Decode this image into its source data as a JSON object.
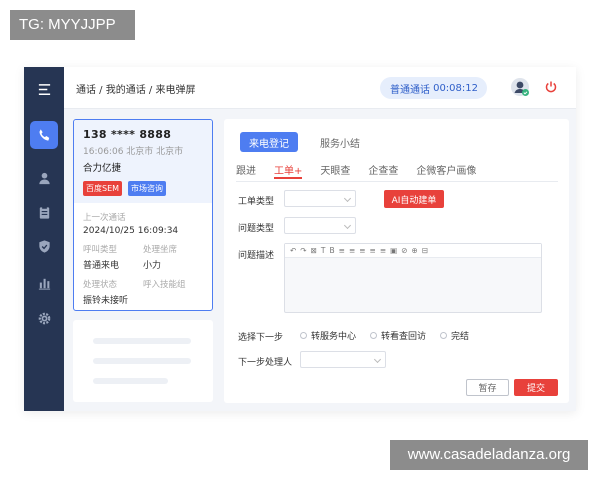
{
  "watermarks": {
    "top_left": "TG: MYYJJPP",
    "bottom_right": "www.casadeladanza.org"
  },
  "header": {
    "breadcrumb": "通话 / 我的通话 / 来电弹屏",
    "call_type": "普通通话",
    "call_timer": "00:08:12"
  },
  "caller_card": {
    "phone": "138 **** 8888",
    "time_location": "16:06:06  北京市 北京市",
    "company": "合力亿捷",
    "tags": [
      "百度SEM",
      "市场咨询"
    ],
    "last_call_label": "上一次通话",
    "last_call_value": "2024/10/25  16:09:34",
    "call_type_label": "呼叫类型",
    "call_type_value": "普通来电",
    "handler_label": "处理坐席",
    "handler_value": "小力",
    "status_label": "处理状态",
    "status_value": "振铃未接听",
    "skill_group_label": "呼入技能组",
    "skill_group_value": ""
  },
  "main": {
    "top_tabs": [
      "来电登记",
      "服务小结"
    ],
    "sub_tabs": [
      "跟进",
      "工单+",
      "天眼查",
      "企查查",
      "企微客户画像"
    ],
    "form": {
      "ticket_type_label": "工单类型",
      "issue_type_label": "问题类型",
      "issue_desc_label": "问题描述",
      "ai_button": "AI自动建单",
      "toolbar": [
        "↶",
        "↷",
        "⊠",
        "T",
        "B",
        "≡",
        "≡",
        "≡",
        "≡",
        "≡",
        "▣",
        "⊘",
        "⊕",
        "⊟"
      ],
      "next_step_label": "选择下一步",
      "next_step_options": [
        "转服务中心",
        "转看查回访",
        "完结"
      ],
      "next_handler_label": "下一步处理人"
    },
    "buttons": {
      "save": "暂存",
      "submit": "提交"
    }
  },
  "colors": {
    "accent": "#4e7df1",
    "danger": "#e8413b",
    "sidebar": "#263553"
  }
}
